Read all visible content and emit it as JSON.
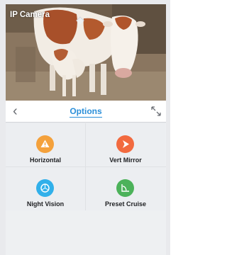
{
  "camera": {
    "title": "IP Camera"
  },
  "toolbar": {
    "back_glyph": "‹",
    "title": "Options",
    "expand_icon": "expand-icon"
  },
  "options": [
    {
      "label": "Horizontal",
      "icon": "warning-triangle-icon",
      "color": "#f4a13c"
    },
    {
      "label": "Vert Mirror",
      "icon": "play-arrow-icon",
      "color": "#f26a3f"
    },
    {
      "label": "Night Vision",
      "icon": "lens-icon",
      "color": "#31b0ea"
    },
    {
      "label": "Preset Cruise",
      "icon": "route-chart-icon",
      "color": "#4cb25a"
    }
  ],
  "colors": {
    "accent": "#2b8fd9",
    "panel_bg": "#eef0f2"
  }
}
